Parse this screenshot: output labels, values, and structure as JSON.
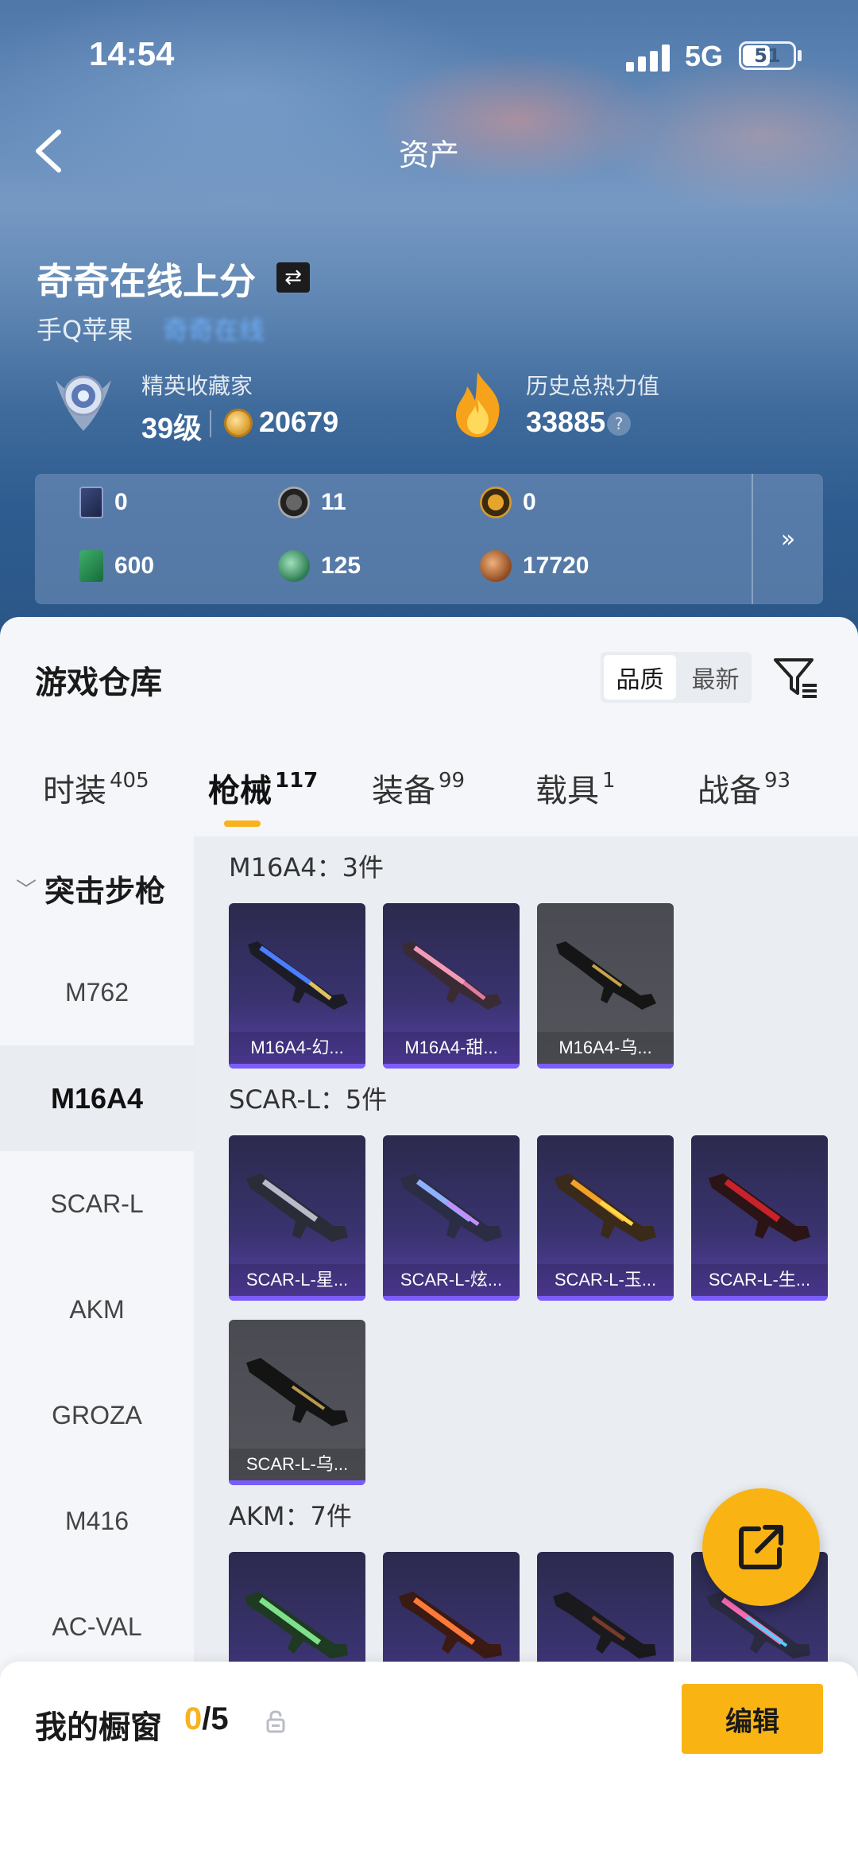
{
  "status": {
    "time": "14:54",
    "network": "5G",
    "battery": "51"
  },
  "header": {
    "title": "资产"
  },
  "profile": {
    "name": "奇奇在线上分",
    "platform": "手Q苹果",
    "platform_link": "奇奇在线",
    "rank_title": "精英收藏家",
    "rank_level": "39级",
    "coins": "20679",
    "heat_title": "历史总热力值",
    "heat_value": "33885",
    "help": "?"
  },
  "currencies": [
    {
      "icon": "card-icon",
      "value": "0"
    },
    {
      "icon": "silver-token-icon",
      "value": "11"
    },
    {
      "icon": "gold-token-icon",
      "value": "0"
    },
    {
      "icon": "green-ticket-icon",
      "value": "600"
    },
    {
      "icon": "jade-coin-icon",
      "value": "125"
    },
    {
      "icon": "bronze-coin-icon",
      "value": "17720"
    }
  ],
  "warehouse": {
    "title": "游戏仓库",
    "sort_options": [
      "品质",
      "最新"
    ],
    "tabs": [
      {
        "label": "时装",
        "count": "405"
      },
      {
        "label": "枪械",
        "count": "117"
      },
      {
        "label": "装备",
        "count": "99"
      },
      {
        "label": "载具",
        "count": "1"
      },
      {
        "label": "战备",
        "count": "93"
      }
    ],
    "category": "突击步枪",
    "side_items": [
      "M762",
      "M16A4",
      "SCAR-L",
      "AKM",
      "GROZA",
      "M416",
      "AC-VAL"
    ],
    "groups": [
      {
        "title": "M16A4：3件",
        "items": [
          "M16A4-幻...",
          "M16A4-甜...",
          "M16A4-乌..."
        ]
      },
      {
        "title": "SCAR-L：5件",
        "items": [
          "SCAR-L-星...",
          "SCAR-L-炫...",
          "SCAR-L-玉...",
          "SCAR-L-生...",
          "SCAR-L-乌..."
        ]
      },
      {
        "title": "AKM：7件"
      }
    ]
  },
  "showcase": {
    "label": "我的橱窗",
    "current": "0",
    "total": "/5",
    "edit_label": "编辑"
  },
  "colors": {
    "accent": "#f9b414",
    "card_purple": "#5840a8",
    "link": "#6fb2ff"
  }
}
